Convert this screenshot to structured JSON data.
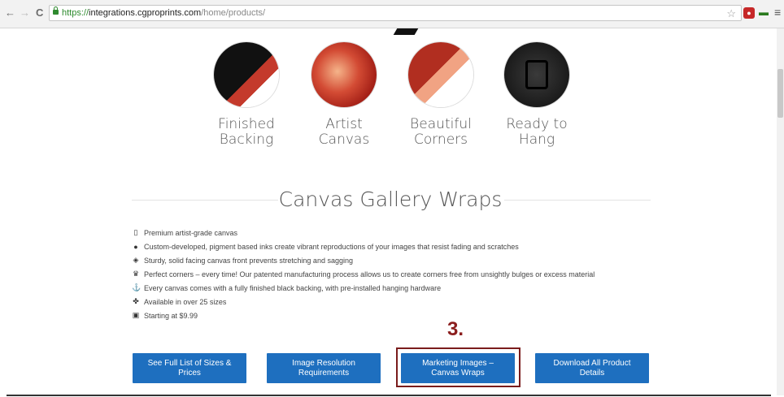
{
  "browser": {
    "url_scheme": "https://",
    "url_host": "integrations.cgproprints.com",
    "url_path": "/home/products/"
  },
  "features": [
    {
      "label_line1": "Finished",
      "label_line2": "Backing"
    },
    {
      "label_line1": "Artist",
      "label_line2": "Canvas"
    },
    {
      "label_line1": "Beautiful",
      "label_line2": "Corners"
    },
    {
      "label_line1": "Ready to",
      "label_line2": "Hang"
    }
  ],
  "section": {
    "title": "Canvas Gallery Wraps",
    "bullets": [
      {
        "icon": "bookmark-icon",
        "text": "Premium artist-grade canvas"
      },
      {
        "icon": "ink-drop-icon",
        "text": "Custom-developed, pigment based inks create vibrant reproductions of your images that resist fading and scratches"
      },
      {
        "icon": "shield-icon",
        "text": "Sturdy, solid facing canvas front prevents stretching and sagging"
      },
      {
        "icon": "trophy-icon",
        "text": "Perfect corners – every time! Our patented manufacturing process allows us to create corners free from unsightly bulges or excess material"
      },
      {
        "icon": "anchor-icon",
        "text": "Every canvas comes with a fully finished black backing, with pre-installed hanging hardware"
      },
      {
        "icon": "sizes-icon",
        "text": "Available in over 25 sizes"
      },
      {
        "icon": "money-icon",
        "text": "Starting at $9.99"
      }
    ]
  },
  "annotation": {
    "step": "3."
  },
  "buttons": [
    {
      "label": "See Full List of Sizes & Prices"
    },
    {
      "label": "Image Resolution Requirements"
    },
    {
      "label": "Marketing Images – Canvas Wraps"
    },
    {
      "label": "Download All Product Details"
    }
  ],
  "colors": {
    "button": "#1e6fbf",
    "highlight": "#7a1c1c"
  }
}
